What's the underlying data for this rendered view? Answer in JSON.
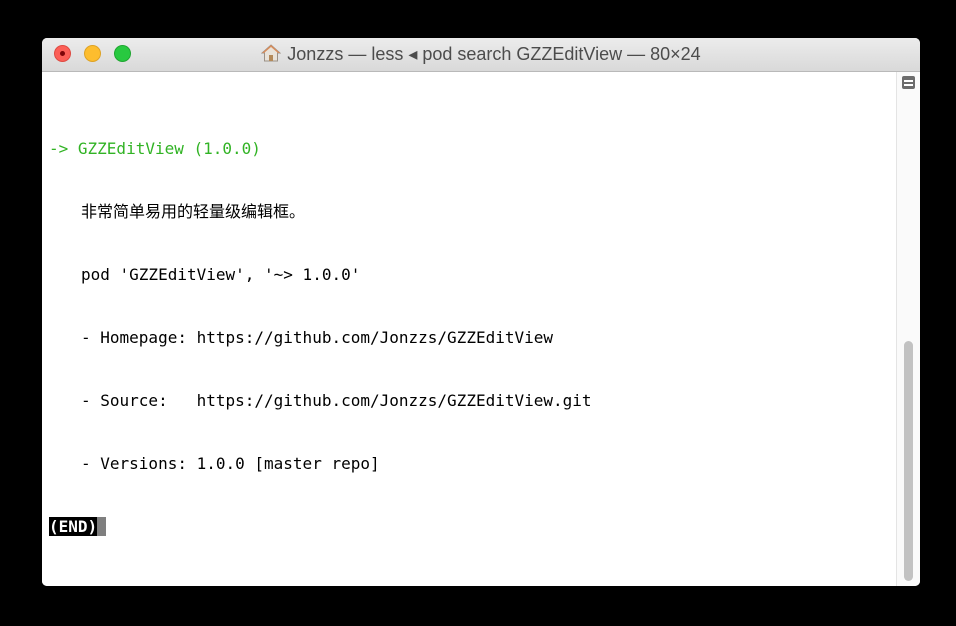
{
  "window": {
    "title": "Jonzzs — less ◂ pod search GZZEditView — 80×24",
    "title_icon": "home-icon"
  },
  "terminal": {
    "header": "-> GZZEditView (1.0.0)",
    "summary": "非常简单易用的轻量级编辑框。",
    "pod_line": "pod 'GZZEditView', '~> 1.0.0'",
    "homepage": "- Homepage: https://github.com/Jonzzs/GZZEditView",
    "source": "- Source:   https://github.com/Jonzzs/GZZEditView.git",
    "versions": "- Versions: 1.0.0 [master repo]",
    "end_marker": "(END)"
  },
  "colors": {
    "header_green": "#31b324",
    "close": "#fc5f57",
    "minimize": "#fdbd2e",
    "zoom": "#28c940"
  }
}
